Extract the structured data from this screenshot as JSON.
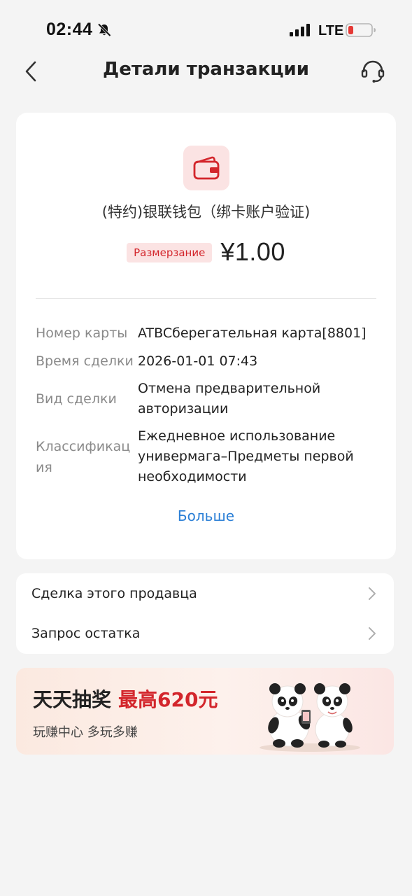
{
  "status_bar": {
    "time": "02:44",
    "network": "LTE",
    "icons": [
      "bell-slash-icon",
      "signal-icon",
      "battery-low-icon"
    ],
    "battery_color": "#e53935"
  },
  "nav": {
    "title": "Детали транзакции",
    "back_icon": "chevron-left-icon",
    "support_icon": "headset-icon"
  },
  "transaction": {
    "icon": "wallet-icon",
    "merchant": "(特约)银联钱包（绑卡账户验证)",
    "status": "Размерзание",
    "amount": "¥1.00",
    "details": [
      {
        "label": "Номер карты",
        "value": "ATBCберегательная карта[8801]"
      },
      {
        "label": "Время сделки",
        "value": "2026-01-01 07:43"
      },
      {
        "label": "Вид сделки",
        "value": "Отмена предварительной авторизации"
      },
      {
        "label": "Классификация",
        "value": "Ежедневное использование универмага–Предметы первой необходимости"
      }
    ],
    "more_label": "Больше"
  },
  "actions": [
    {
      "label": "Сделка этого продавца",
      "icon": "chevron-right-icon"
    },
    {
      "label": "Запрос остатка",
      "icon": "chevron-right-icon"
    }
  ],
  "promo": {
    "title": "天天抽奖",
    "highlight": "最高620元",
    "subtitle": "玩赚中心 多玩多赚",
    "image": "panda-mascots"
  },
  "colors": {
    "accent_red": "#d3262c",
    "link_blue": "#2b7fd6",
    "background": "#f4f4f4",
    "card": "#ffffff"
  }
}
